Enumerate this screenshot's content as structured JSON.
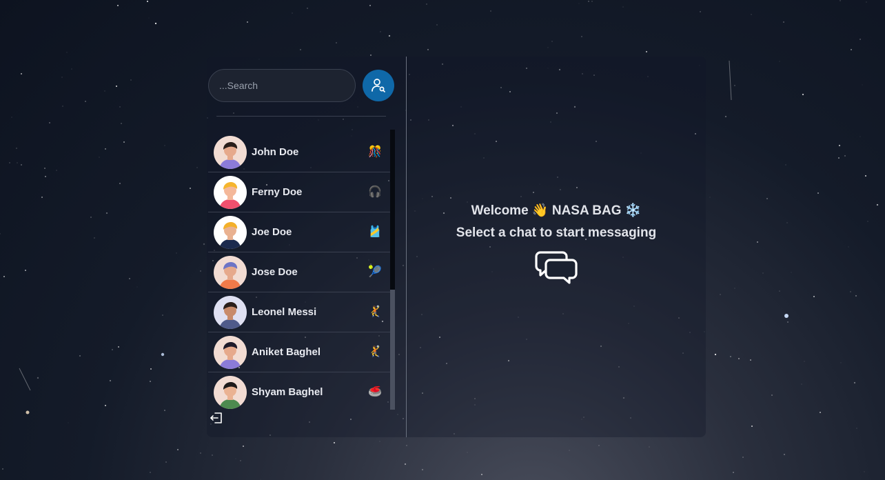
{
  "search": {
    "placeholder": "...Search"
  },
  "search_button": {
    "icon": "user-search-icon",
    "color": "#0f68a8"
  },
  "conversations": [
    {
      "name": "John Doe",
      "emoji": "🎊",
      "avatar_colors": {
        "bg": "#f2dcd3",
        "hair": "#2a1e1a",
        "skin": "#e6a98c",
        "shirt": "#8b7bd8"
      }
    },
    {
      "name": "Ferny Doe",
      "emoji": "🎧",
      "avatar_colors": {
        "bg": "#ffffff",
        "hair": "#f5b52e",
        "skin": "#f4b89a",
        "shirt": "#f0506e"
      }
    },
    {
      "name": "Joe Doe",
      "emoji": "🎽",
      "avatar_colors": {
        "bg": "#ffffff",
        "hair": "#f3b02a",
        "skin": "#e9b190",
        "shirt": "#1b2a4e"
      }
    },
    {
      "name": "Jose Doe",
      "emoji": "🎾",
      "avatar_colors": {
        "bg": "#f2dcd3",
        "hair": "#6d74c6",
        "skin": "#e6a98c",
        "shirt": "#f07a4a"
      }
    },
    {
      "name": "Leonel Messi",
      "emoji": "🤾",
      "avatar_colors": {
        "bg": "#dfe0f2",
        "hair": "#2a1e1a",
        "skin": "#c88a6a",
        "shirt": "#4f5a8a"
      }
    },
    {
      "name": "Aniket Baghel",
      "emoji": "🤾",
      "avatar_colors": {
        "bg": "#f2dcd3",
        "hair": "#1e1a2a",
        "skin": "#e6a98c",
        "shirt": "#8b7bd8"
      }
    },
    {
      "name": "Shyam Baghel",
      "emoji": "🥌",
      "avatar_colors": {
        "bg": "#f2dcd3",
        "hair": "#1e1a1a",
        "skin": "#eab292",
        "shirt": "#4d8a4f"
      }
    }
  ],
  "logout": {
    "icon": "logout-icon"
  },
  "welcome": {
    "greeting": "Welcome 👋 NASA BAG ❄️",
    "subtitle": "Select a chat to start messaging",
    "icon": "chat-bubbles-icon"
  }
}
